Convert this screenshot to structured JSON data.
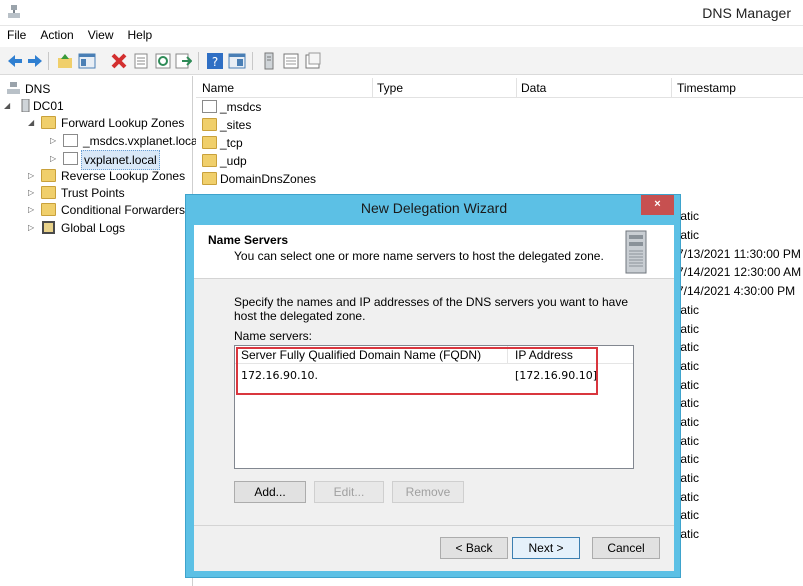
{
  "window": {
    "title": "DNS Manager"
  },
  "menu": [
    "File",
    "Action",
    "View",
    "Help"
  ],
  "toolbar": {
    "icons": [
      "back-icon",
      "forward-icon",
      "up-folder-icon",
      "show-hide-tree-icon",
      "delete-icon",
      "properties-icon",
      "refresh-icon",
      "export-icon",
      "help-icon",
      "console-icon",
      "server-icon",
      "zone-icon",
      "records-icon"
    ]
  },
  "tree": {
    "root": "DNS",
    "server": "DC01",
    "forward_zones": "Forward Lookup Zones",
    "zone_msdcs": "_msdcs.vxplanet.loca",
    "zone_vxplanet": "vxplanet.local",
    "reverse_zones": "Reverse Lookup Zones",
    "trust_points": "Trust Points",
    "conditional_forwarders": "Conditional Forwarders",
    "global_logs": "Global Logs"
  },
  "list": {
    "columns": [
      "Name",
      "Type",
      "Data",
      "Timestamp"
    ],
    "rows": [
      "_msdcs",
      "_sites",
      "_tcp",
      "_udp",
      "DomainDnsZones"
    ],
    "timestamps": [
      "tatic",
      "tatic",
      "7/13/2021 11:30:00 PM",
      "7/14/2021 12:30:00 AM",
      "7/14/2021 4:30:00 PM",
      "tatic",
      "tatic",
      "tatic",
      "tatic",
      "tatic",
      "tatic",
      "tatic",
      "tatic",
      "tatic",
      "tatic",
      "tatic",
      "tatic",
      "tatic"
    ]
  },
  "dialog": {
    "title": "New Delegation Wizard",
    "close": "×",
    "heading": "Name Servers",
    "subheading": "You can select one or more name servers to host the delegated zone.",
    "instructions": "Specify the names and IP addresses of the DNS servers you want to have host the delegated zone.",
    "name_servers_label": "Name servers:",
    "table": {
      "columns": [
        "Server Fully Qualified Domain Name (FQDN)",
        "IP Address"
      ],
      "rows": [
        {
          "fqdn": "172.16.90.10.",
          "ip": "[172.16.90.10]"
        }
      ]
    },
    "buttons": {
      "add": "Add...",
      "edit": "Edit...",
      "remove": "Remove",
      "back": "< Back",
      "next": "Next >",
      "cancel": "Cancel"
    }
  },
  "colors": {
    "dialog_frame": "#5cc0e5",
    "close_button": "#c75050",
    "highlight_box": "#d9363e",
    "folder": "#f0cf6b"
  }
}
